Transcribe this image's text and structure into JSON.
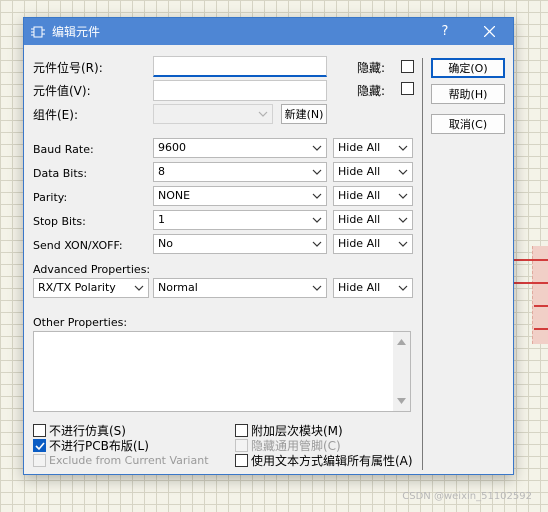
{
  "window": {
    "title": "编辑元件"
  },
  "fields": {
    "designator_label": "元件位号(R):",
    "designator_value": "",
    "value_label": "元件值(V):",
    "value_value": "",
    "group_label": "组件(E):",
    "group_value": "",
    "hidden_label_1": "隐藏:",
    "hidden_label_2": "隐藏:",
    "new_button": "新建(N)"
  },
  "buttons": {
    "ok": "确定(O)",
    "help": "帮助(H)",
    "cancel": "取消(C)"
  },
  "properties": [
    {
      "label": "Baud Rate:",
      "value": "9600",
      "visibility": "Hide All"
    },
    {
      "label": "Data Bits:",
      "value": "8",
      "visibility": "Hide All"
    },
    {
      "label": "Parity:",
      "value": "NONE",
      "visibility": "Hide All"
    },
    {
      "label": "Stop Bits:",
      "value": "1",
      "visibility": "Hide All"
    },
    {
      "label": "Send XON/XOFF:",
      "value": "No",
      "visibility": "Hide All"
    }
  ],
  "advanced": {
    "label": "Advanced Properties:",
    "name": "RX/TX Polarity",
    "value": "Normal",
    "visibility": "Hide All"
  },
  "other": {
    "label": "Other Properties:",
    "text": ""
  },
  "checkboxes": {
    "exclude_sim": {
      "label": "不进行仿真(S)",
      "checked": false
    },
    "exclude_pcb": {
      "label": "不进行PCB布版(L)",
      "checked": true
    },
    "exclude_variant": {
      "label": "Exclude from Current Variant",
      "checked": false
    },
    "attach_hierarchy": {
      "label": "附加层次模块(M)",
      "checked": false
    },
    "hide_pins": {
      "label": "隐藏通用管脚(C)",
      "checked": false
    },
    "edit_as_text": {
      "label": "使用文本方式编辑所有属性(A)",
      "checked": false
    }
  },
  "watermark": "CSDN @weixin_51102592",
  "colors": {
    "titlebar": "#4e86d4",
    "accent": "#0a5cc4",
    "wire": "#d23b3b"
  }
}
